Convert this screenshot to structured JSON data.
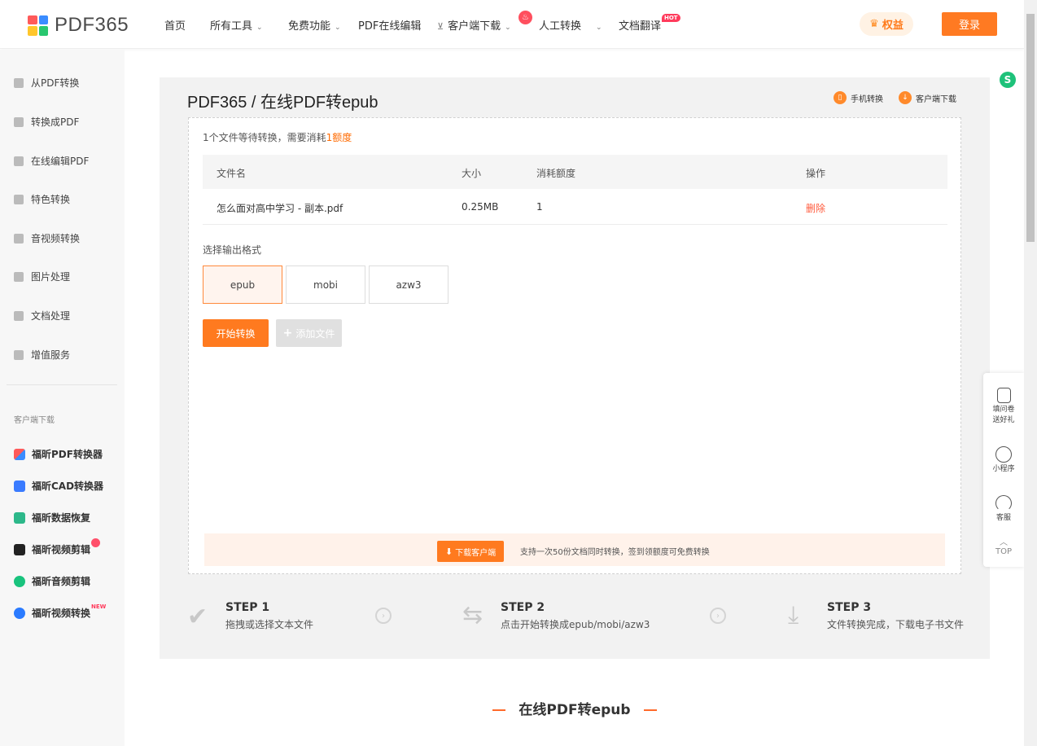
{
  "brand": {
    "name": "PDF365",
    "logo_colors": [
      "#ff5a5a",
      "#3a8cff",
      "#ffc62b",
      "#28c76f"
    ]
  },
  "nav": {
    "items": [
      "首页",
      "所有工具",
      "免费功能",
      "PDF在线编辑",
      "客户端下载",
      "人工转换",
      "文档翻译"
    ],
    "hot_badge": "HOT",
    "quanyi": "权益",
    "login": "登录"
  },
  "sidebar": {
    "items": [
      "从PDF转换",
      "转换成PDF",
      "在线编辑PDF",
      "特色转换",
      "音视频转换",
      "图片处理",
      "文档处理",
      "增值服务"
    ],
    "section_title": "客户端下载",
    "apps": [
      "福昕PDF转换器",
      "福昕CAD转换器",
      "福昕数据恢复",
      "福昕视频剪辑",
      "福昕音频剪辑",
      "福昕视频转换"
    ],
    "new_badge": "NEW"
  },
  "main": {
    "breadcrumb": "PDF365 / 在线PDF转epub",
    "mobile_convert": "手机转换",
    "client_download": "客户端下载",
    "info_text": "1个文件等待转换，需要消耗",
    "info_highlight": "1额度",
    "table": {
      "headers": [
        "文件名",
        "大小",
        "消耗额度",
        "操作"
      ],
      "rows": [
        {
          "name": "怎么面对高中学习 - 副本.pdf",
          "size": "0.25MB",
          "cost": "1",
          "action": "删除"
        }
      ]
    },
    "format_label": "选择输出格式",
    "formats": [
      "epub",
      "mobi",
      "azw3"
    ],
    "selected_format": "epub",
    "start_button": "开始转换",
    "add_button": "添加文件",
    "download_client": "下载客户端",
    "bottom_text": "支持一次50份文档同时转换，签到领额度可免费转换"
  },
  "steps": [
    {
      "title": "STEP 1",
      "desc": "拖拽或选择文本文件"
    },
    {
      "title": "STEP 2",
      "desc": "点击开始转换成epub/mobi/azw3"
    },
    {
      "title": "STEP 3",
      "desc": "文件转换完成，下载电子书文件"
    }
  ],
  "section_title": "在线PDF转epub",
  "float_panel": {
    "survey": "填问卷送好礼",
    "mini_program": "小程序",
    "service": "客服",
    "top": "TOP"
  },
  "colors": {
    "accent": "#ff7a1f",
    "highlight": "#ff6a00",
    "delete": "#ff5a3c"
  }
}
